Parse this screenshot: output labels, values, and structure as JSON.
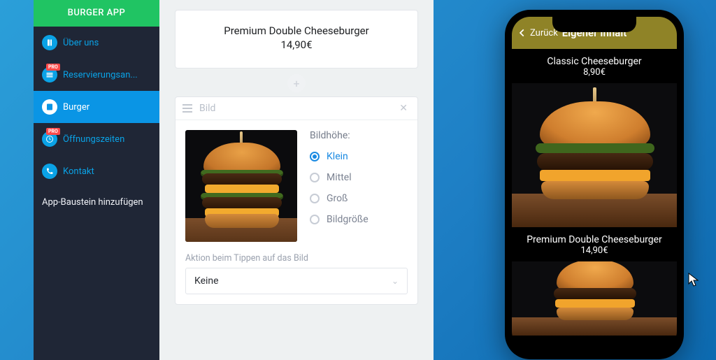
{
  "brand": "BURGER APP",
  "sidebar": {
    "items": [
      {
        "label": "Über uns",
        "icon": "info"
      },
      {
        "label": "Reservierungsan...",
        "icon": "calendar",
        "pro": true
      },
      {
        "label": "Burger",
        "icon": "page",
        "active": true
      },
      {
        "label": "Öffnungszeiten",
        "icon": "clock",
        "pro": true
      },
      {
        "label": "Kontakt",
        "icon": "phone"
      }
    ],
    "add_label": "App-Baustein hinzufügen",
    "pro_badge": "PRO"
  },
  "editor": {
    "text_block": {
      "title": "Premium Double Cheeseburger",
      "price": "14,90€"
    },
    "image_block": {
      "header_label": "Bild",
      "height_label": "Bildhöhe:",
      "options": [
        {
          "label": "Klein",
          "selected": true
        },
        {
          "label": "Mittel",
          "selected": false
        },
        {
          "label": "Groß",
          "selected": false
        },
        {
          "label": "Bildgröße",
          "selected": false
        }
      ],
      "action_label": "Aktion beim Tippen auf das Bild",
      "action_value": "Keine"
    }
  },
  "phone": {
    "back_label": "Zurück",
    "header_title": "Eigener Inhalt",
    "items": [
      {
        "title": "Classic Cheeseburger",
        "price": "8,90€"
      },
      {
        "title": "Premium Double Cheeseburger",
        "price": "14,90€"
      }
    ]
  }
}
